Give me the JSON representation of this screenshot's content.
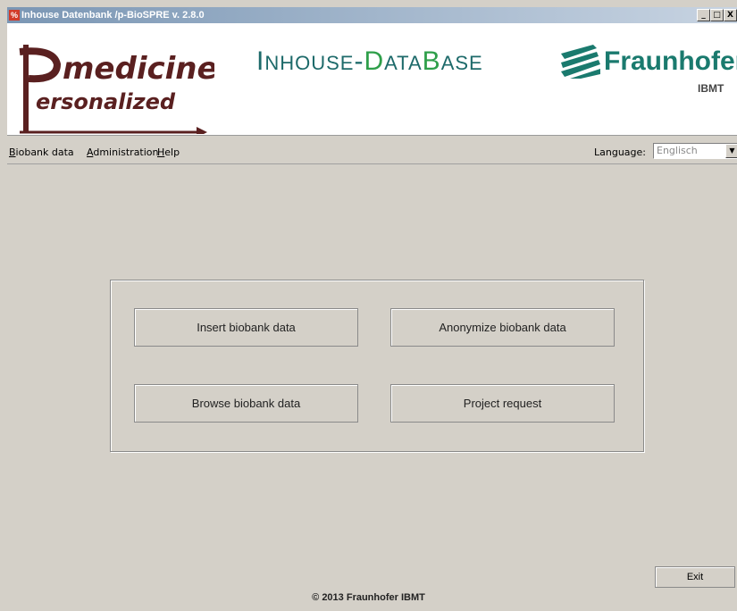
{
  "window": {
    "title": "Inhouse Datenbank /p-BioSPRE v. 2.8.0",
    "controls": [
      "_",
      "□",
      "X"
    ]
  },
  "header": {
    "logo_left": {
      "line1": "medicine",
      "line2": "ersonalized",
      "initial": "P"
    },
    "db_title": {
      "i": "I",
      "nhouse": "NHOUSE",
      "dash": "-",
      "d": "D",
      "ata": "ATA",
      "b": "B",
      "ase": "ASE"
    },
    "fraunhofer": {
      "name": "Fraunhofer",
      "sub": "IBMT"
    }
  },
  "menu": {
    "items": [
      {
        "first": "B",
        "rest": "iobank data"
      },
      {
        "first": "A",
        "rest": "dministration"
      },
      {
        "first": "H",
        "rest": "elp"
      }
    ],
    "language_label": "Language:",
    "language_value": "Englisch"
  },
  "actions": {
    "insert": "Insert biobank data",
    "anonymize": "Anonymize biobank data",
    "browse": "Browse biobank data",
    "project": "Project request"
  },
  "exit_label": "Exit",
  "footer": "© 2013 Fraunhofer IBMT",
  "colors": {
    "brand_dark_red": "#5a2020",
    "db_teal": "#1d6a6a",
    "db_green": "#2f9f4a",
    "fraunhofer_green": "#1a7a6e"
  }
}
